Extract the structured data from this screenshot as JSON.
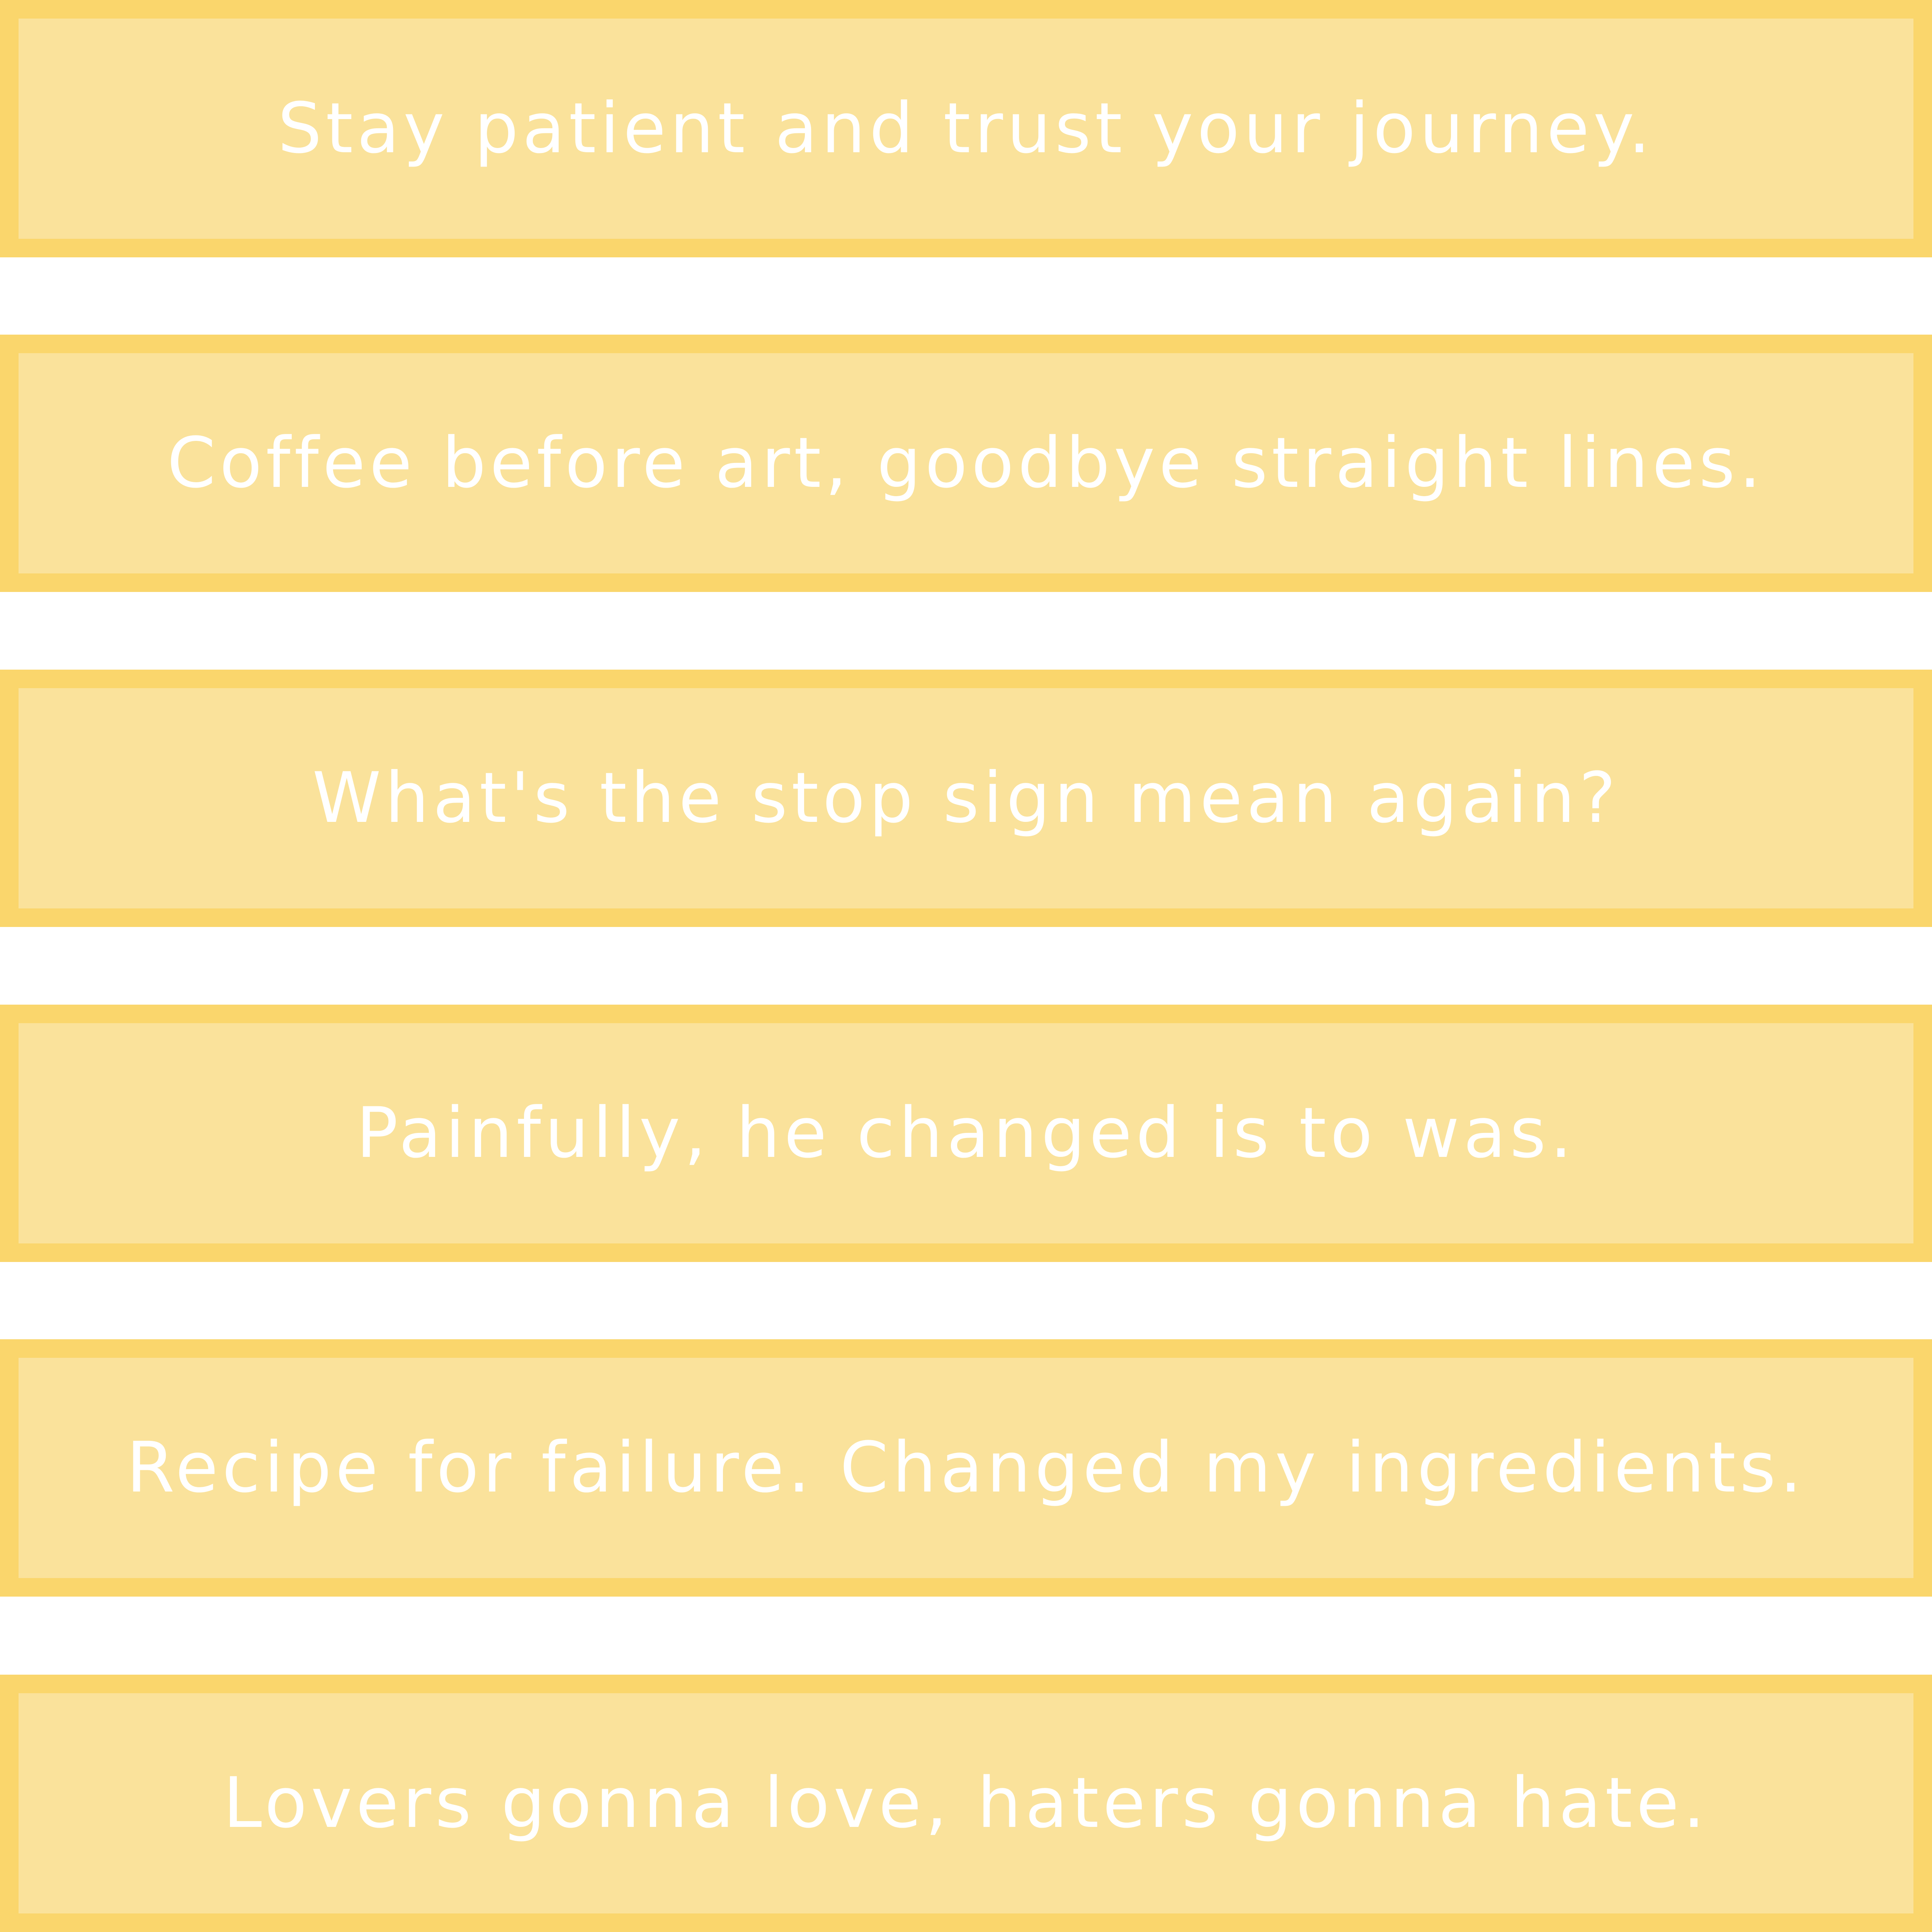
{
  "colors": {
    "card_border": "#fad66c",
    "card_fill": "#fae29b",
    "text": "#ffffff",
    "background": "#ffffff"
  },
  "quotes": [
    "Stay patient and trust your journey.",
    "Coffee before art, goodbye straight lines.",
    "What's the stop sign mean again?",
    "Painfully, he changed is to was.",
    "Recipe for failure. Changed my ingredients.",
    "Lovers gonna love, haters gonna hate."
  ]
}
